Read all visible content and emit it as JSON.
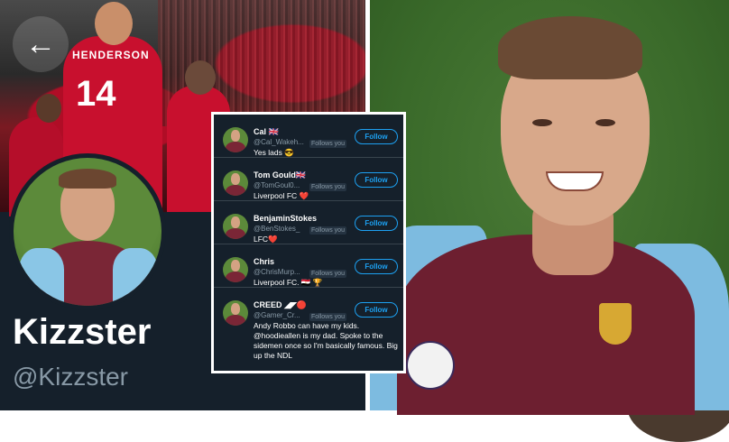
{
  "profile": {
    "back_icon": "arrow-left-icon",
    "display_name": "Kizzster",
    "handle": "@Kizzster",
    "banner_player_name": "HENDERSON",
    "banner_player_number": "14"
  },
  "replies": [
    {
      "name": "Cal 🇬🇧",
      "handle": "@Cal_Wakeh...",
      "follows": "Follows you",
      "text": "Yes lads 😎",
      "follow_label": "Follow"
    },
    {
      "name": "Tom Gould🇬🇧",
      "handle": "@TomGoul0...",
      "follows": "Follows you",
      "text": "Liverpool FC ❤️",
      "follow_label": "Follow"
    },
    {
      "name": "BenjaminStokes",
      "handle": "@BenStokes_",
      "follows": "Follows you",
      "text": "LFC❤️",
      "follow_label": "Follow"
    },
    {
      "name": "Chris",
      "handle": "@ChrisMurp...",
      "follows": "Follows you",
      "text": "Liverpool FC. 🇪🇬 🏆",
      "follow_label": "Follow"
    },
    {
      "name": "CREED ◢◤🔴",
      "handle": "@Gamer_Cr...",
      "follows": "Follows you",
      "text": "Andy Robbo can have my kids. @hoodieallen is my dad. Spoke to the sidemen once so I'm basically famous. Big up the NDL",
      "follow_label": "Follow"
    }
  ],
  "colors": {
    "accent": "#1da1f2",
    "background": "#15202b",
    "muted": "#8899a6"
  }
}
